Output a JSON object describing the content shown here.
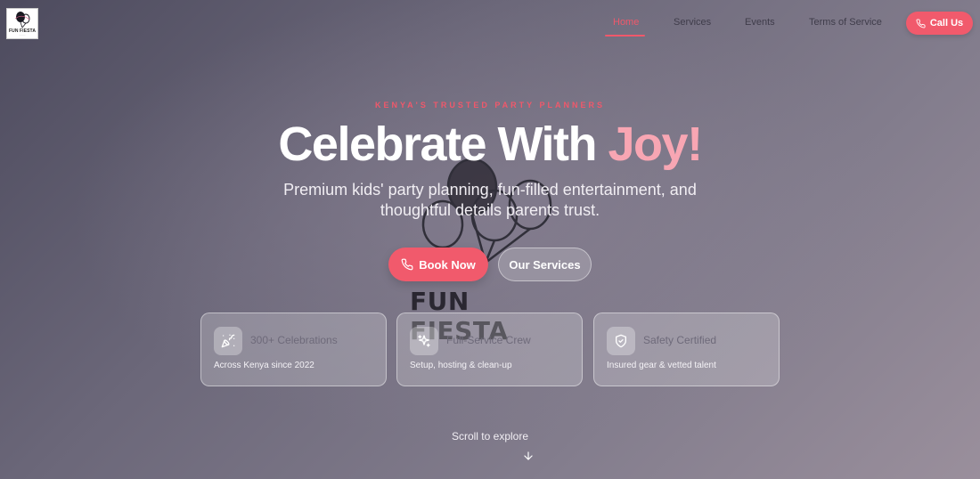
{
  "brand": {
    "logo_text": "FUN FIESTA",
    "watermark_text": "FUN FIESTA"
  },
  "nav": {
    "items": [
      {
        "label": "Home",
        "active": true
      },
      {
        "label": "Services",
        "active": false
      },
      {
        "label": "Events",
        "active": false
      },
      {
        "label": "Terms of Service",
        "active": false
      }
    ],
    "call_label": "Call Us"
  },
  "hero": {
    "eyebrow": "KENYA'S TRUSTED PARTY PLANNERS",
    "title_main": "Celebrate With ",
    "title_accent": "Joy!",
    "subtitle": "Premium kids' party planning, fun-filled entertainment, and thoughtful details parents trust.",
    "book_label": "Book Now",
    "services_label": "Our Services"
  },
  "features": [
    {
      "icon": "party-popper-icon",
      "title": "300+ Celebrations",
      "desc": "Across Kenya since 2022"
    },
    {
      "icon": "sparkles-icon",
      "title": "Full-Service Crew",
      "desc": "Setup, hosting & clean-up"
    },
    {
      "icon": "shield-check-icon",
      "title": "Safety Certified",
      "desc": "Insured gear & vetted talent"
    }
  ],
  "scroll_hint": "Scroll to explore",
  "colors": {
    "accent": "#f15a6c",
    "accent_light": "#f8a6b3"
  }
}
